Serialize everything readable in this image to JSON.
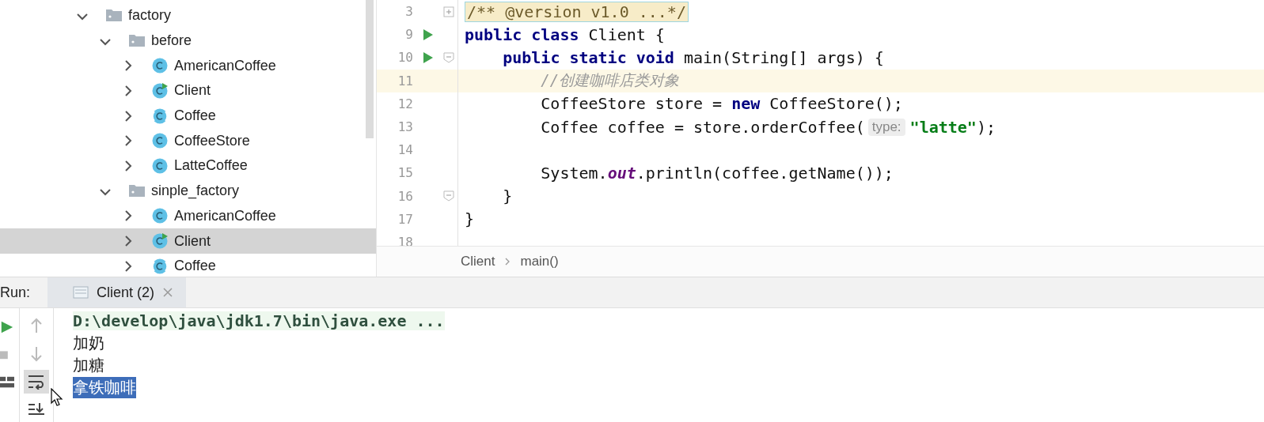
{
  "project_tree": [
    {
      "label": "factory",
      "kind": "folder",
      "expanded": true,
      "selected": false,
      "children": [
        {
          "label": "before",
          "kind": "folder",
          "expanded": true,
          "selected": false,
          "children": [
            {
              "label": "AmericanCoffee",
              "kind": "class",
              "expanded": false,
              "selected": false
            },
            {
              "label": "Client",
              "kind": "runnable",
              "expanded": false,
              "selected": false
            },
            {
              "label": "Coffee",
              "kind": "abstract",
              "expanded": false,
              "selected": false
            },
            {
              "label": "CoffeeStore",
              "kind": "class",
              "expanded": false,
              "selected": false
            },
            {
              "label": "LatteCoffee",
              "kind": "class",
              "expanded": false,
              "selected": false
            }
          ]
        },
        {
          "label": "sinple_factory",
          "kind": "folder",
          "expanded": true,
          "selected": false,
          "children": [
            {
              "label": "AmericanCoffee",
              "kind": "class",
              "expanded": false,
              "selected": false
            },
            {
              "label": "Client",
              "kind": "runnable",
              "expanded": false,
              "selected": true
            },
            {
              "label": "Coffee",
              "kind": "abstract",
              "expanded": false,
              "selected": false
            }
          ]
        }
      ]
    }
  ],
  "editor": {
    "lines": [
      {
        "number": "3",
        "folded": true,
        "tokens": [
          {
            "text": "/** @version v1.0 ...*/",
            "kind": "folded"
          }
        ]
      },
      {
        "number": "9",
        "run": true,
        "tokens": [
          {
            "text": "public class ",
            "kind": "keyword"
          },
          {
            "text": "Client {",
            "kind": "plain"
          }
        ]
      },
      {
        "number": "10",
        "run": true,
        "folded": false,
        "tokens": [
          {
            "text": "    public static void ",
            "kind": "keyword"
          },
          {
            "text": "main(String[] args) {",
            "kind": "plain"
          }
        ]
      },
      {
        "number": "11",
        "current": true,
        "tokens": [
          {
            "text": "        //创建咖啡店类对象",
            "kind": "comment"
          }
        ]
      },
      {
        "number": "12",
        "tokens": [
          {
            "text": "        CoffeeStore store = ",
            "kind": "plain"
          },
          {
            "text": "new ",
            "kind": "keyword"
          },
          {
            "text": "CoffeeStore();",
            "kind": "plain"
          }
        ]
      },
      {
        "number": "13",
        "tokens": [
          {
            "text": "        Coffee coffee = store.orderCoffee(",
            "kind": "plain"
          },
          {
            "text": "type:",
            "kind": "hint"
          },
          {
            "text": "\"latte\"",
            "kind": "string"
          },
          {
            "text": ");",
            "kind": "plain"
          }
        ]
      },
      {
        "number": "14"
      },
      {
        "number": "15",
        "tokens": [
          {
            "text": "        System.",
            "kind": "plain"
          },
          {
            "text": "out",
            "kind": "field"
          },
          {
            "text": ".println(coffee.getName());",
            "kind": "plain"
          }
        ]
      },
      {
        "number": "16",
        "folded": false,
        "tokens": [
          {
            "text": "    }",
            "kind": "plain"
          }
        ]
      },
      {
        "number": "17",
        "tokens": [
          {
            "text": "}",
            "kind": "plain"
          }
        ]
      },
      {
        "number": "18"
      }
    ],
    "breadcrumb": [
      "Client",
      "main()"
    ]
  },
  "run_panel": {
    "label": "Run:",
    "tab": {
      "title": "Client (2)",
      "selected": true
    },
    "console": [
      {
        "text": "D:\\develop\\java\\jdk1.7\\bin\\java.exe ...",
        "kind": "command",
        "selected": false
      },
      {
        "text": "加奶",
        "kind": "output",
        "selected": false
      },
      {
        "text": "加糖",
        "kind": "output",
        "selected": false
      },
      {
        "text": "拿铁咖啡",
        "kind": "output",
        "selected": true
      }
    ]
  }
}
